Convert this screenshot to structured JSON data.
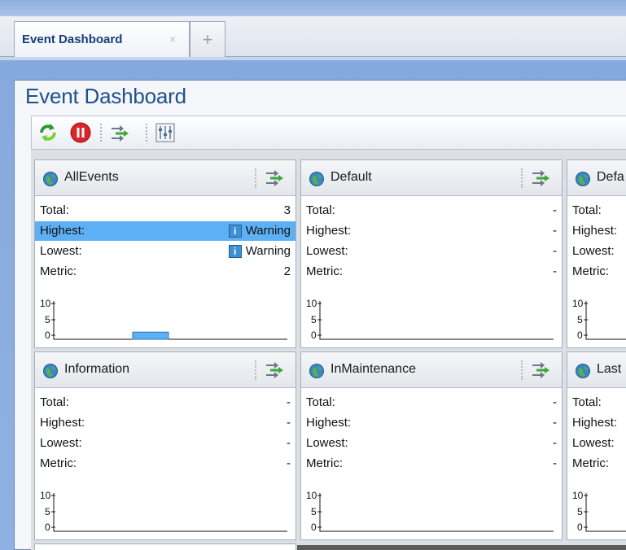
{
  "tabs": [
    {
      "label": "Event Dashboard",
      "close": "×"
    }
  ],
  "new_tab_label": "+",
  "page_title": "Event Dashboard",
  "toolbar": {
    "buttons": [
      "refresh-icon",
      "stop-icon",
      "transfer-icon",
      "settings-sliders-icon"
    ]
  },
  "row_labels": {
    "total": "Total:",
    "highest": "Highest:",
    "lowest": "Lowest:",
    "metric": "Metric:"
  },
  "chart_axis": {
    "ticks": [
      "10",
      "5",
      "0"
    ]
  },
  "cards": [
    {
      "title": "AllEvents",
      "total": "3",
      "highest": "Warning",
      "lowest": "Warning",
      "metric": "2",
      "highlight_row": "highest",
      "bar_level": 2
    },
    {
      "title": "Default",
      "total": "-",
      "highest": "-",
      "lowest": "-",
      "metric": "-"
    },
    {
      "title": "Defa",
      "total": "",
      "highest": "",
      "lowest": "",
      "metric": ""
    },
    {
      "title": "Information",
      "total": "-",
      "highest": "-",
      "lowest": "-",
      "metric": "-"
    },
    {
      "title": "InMaintenance",
      "total": "-",
      "highest": "-",
      "lowest": "-",
      "metric": "-"
    },
    {
      "title": "Last",
      "total": "",
      "highest": "",
      "lowest": "",
      "metric": ""
    }
  ],
  "colors": {
    "highlight": "#5eb0f4",
    "bar": "#5eb0f4",
    "title": "#1f5189"
  }
}
